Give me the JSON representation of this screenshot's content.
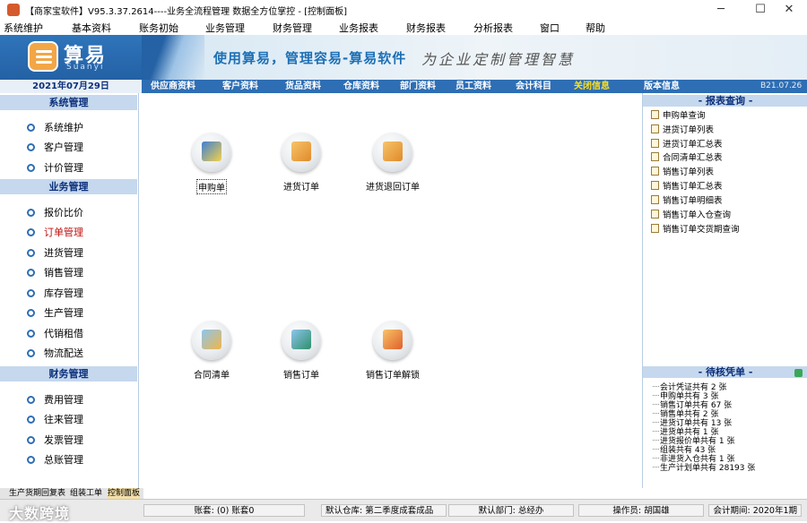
{
  "window": {
    "title": "【商家宝软件】V95.3.37.2614----业务全流程管理 数据全方位掌控 - [控制面板]",
    "minimize_symbol": "─",
    "maximize_symbol": "☐",
    "close_symbol": "✕"
  },
  "menu": [
    "系统维护",
    "基本资料",
    "账务初始",
    "业务管理",
    "财务管理",
    "业务报表",
    "财务报表",
    "分析报表",
    "窗口",
    "帮助"
  ],
  "banner": {
    "logo_cn": "算易",
    "logo_en": "Suanyi",
    "slogan": "使用算易，管理容易-算易软件",
    "slogan2": "为企业定制管理智慧"
  },
  "nav": {
    "date": "2021年07月29日",
    "links": [
      "供应商资料",
      "客户资料",
      "货品资料",
      "仓库资料",
      "部门资料",
      "员工资料",
      "会计科目",
      "关闭信息",
      "版本信息"
    ],
    "version": "B21.07.26"
  },
  "sidebar": {
    "sections": [
      {
        "title": "系统管理",
        "items": [
          "系统维护",
          "客户管理",
          "计价管理"
        ]
      },
      {
        "title": "业务管理",
        "items": [
          "报价比价",
          "订单管理",
          "进货管理",
          "销售管理",
          "库存管理",
          "生产管理",
          "代销租借",
          "物流配送"
        ]
      },
      {
        "title": "财务管理",
        "items": [
          "费用管理",
          "往来管理",
          "发票管理",
          "总账管理"
        ]
      }
    ],
    "active_item": "订单管理"
  },
  "main": {
    "tiles": [
      {
        "label": "申购单",
        "icon": "purchase-request-icon",
        "color": "#3f7fd6"
      },
      {
        "label": "进货订单",
        "icon": "purchase-order-icon",
        "color": "#f2a646"
      },
      {
        "label": "进货退回订单",
        "icon": "purchase-return-order-icon",
        "color": "#f2a646"
      },
      {
        "label": "合同清单",
        "icon": "contract-list-icon",
        "color": "#4aa0d8"
      },
      {
        "label": "销售订单",
        "icon": "sales-order-icon",
        "color": "#4aa0d8"
      },
      {
        "label": "销售订单解锁",
        "icon": "sales-order-unlock-icon",
        "color": "#f08a3a"
      }
    ],
    "selected_tile": "申购单"
  },
  "reports": {
    "title": "- 报表查询 -",
    "items": [
      "申购单查询",
      "进货订单列表",
      "进货订单汇总表",
      "合同清单汇总表",
      "销售订单列表",
      "销售订单汇总表",
      "销售订单明细表",
      "销售订单入仓查询",
      "销售订单交货期查询"
    ]
  },
  "pending": {
    "title": "- 待核凭单 -",
    "items": [
      "会计凭证共有 2 张",
      "申购单共有 3 张",
      "销售订单共有 67 张",
      "销售单共有 2 张",
      "进货订单共有 13 张",
      "进货单共有 1 张",
      "进货报价单共有 1 张",
      "组装共有 43 张",
      "非进货入仓共有 1 张",
      "生产计划单共有 28193 张"
    ]
  },
  "tabs": [
    "生产货期回复表",
    "组装工单",
    "控制面板"
  ],
  "active_tab": "控制面板",
  "status": {
    "account": "账套: (0) 账套0",
    "warehouse": "默认仓库: 第二季度成套成品",
    "department": "默认部门: 总经办",
    "operator": "操作员: 胡国雄",
    "period": "会计期间: 2020年1期"
  },
  "watermark": "大数跨境",
  "colors": {
    "nav_blue": "#2e6eb4",
    "section_header": "#c5d8ee",
    "active_red": "#c0100e",
    "highlight_yellow": "#ffe11f"
  }
}
